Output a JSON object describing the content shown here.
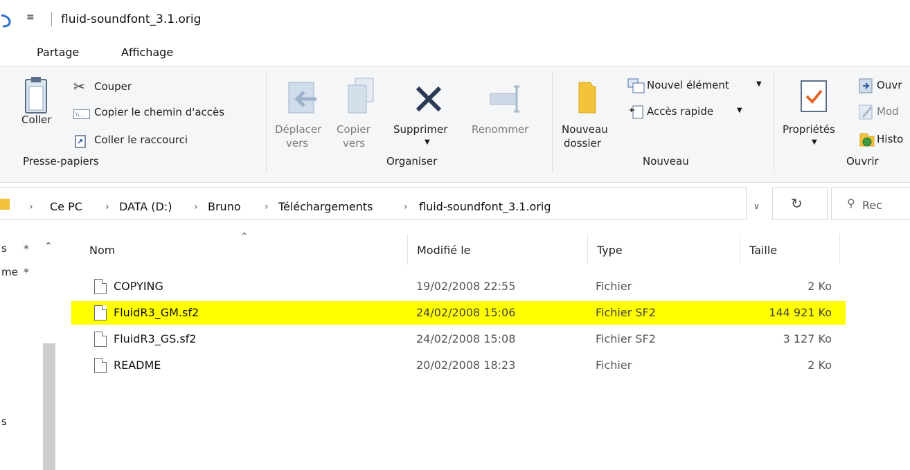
{
  "window": {
    "title": "fluid-soundfont_3.1.orig"
  },
  "tabs": [
    "Partage",
    "Affichage"
  ],
  "ribbon": {
    "clipboard": {
      "paste": "Coller",
      "cut": "Couper",
      "copy_path": "Copier le chemin d'accès",
      "paste_shortcut": "Coller le raccourci",
      "group": "Presse-papiers"
    },
    "organize": {
      "move_l1": "Déplacer",
      "move_l2": "vers",
      "copy_l1": "Copier",
      "copy_l2": "vers",
      "delete": "Supprimer",
      "rename": "Renommer",
      "group": "Organiser"
    },
    "new": {
      "folder_l1": "Nouveau",
      "folder_l2": "dossier",
      "new_item": "Nouvel élément",
      "easy_access": "Accès rapide",
      "group": "Nouveau"
    },
    "open": {
      "properties": "Propriétés",
      "open": "Ouvr",
      "modify": "Mod",
      "history": "Histo",
      "group": "Ouvrir"
    }
  },
  "address": {
    "crumbs": [
      "Ce PC",
      "DATA (D:)",
      "Bruno",
      "Téléchargements",
      "fluid-soundfont_3.1.orig"
    ],
    "search_placeholder": "Rec"
  },
  "nav_pane": {
    "item1": "s",
    "item2": "me",
    "item3": "s"
  },
  "columns": {
    "name": "Nom",
    "modified": "Modifié le",
    "type": "Type",
    "size": "Taille"
  },
  "files": [
    {
      "name": "COPYING",
      "modified": "19/02/2008 22:55",
      "type": "Fichier",
      "size": "2 Ko",
      "highlighted": false
    },
    {
      "name": "FluidR3_GM.sf2",
      "modified": "24/02/2008 15:06",
      "type": "Fichier SF2",
      "size": "144 921 Ko",
      "highlighted": true
    },
    {
      "name": "FluidR3_GS.sf2",
      "modified": "24/02/2008 15:08",
      "type": "Fichier SF2",
      "size": "3 127 Ko",
      "highlighted": false
    },
    {
      "name": "README",
      "modified": "20/02/2008 18:23",
      "type": "Fichier",
      "size": "2 Ko",
      "highlighted": false
    }
  ],
  "colors": {
    "highlight": "#ffff00",
    "delete_icon": "#2b3a55",
    "folder": "#f3c33c"
  }
}
